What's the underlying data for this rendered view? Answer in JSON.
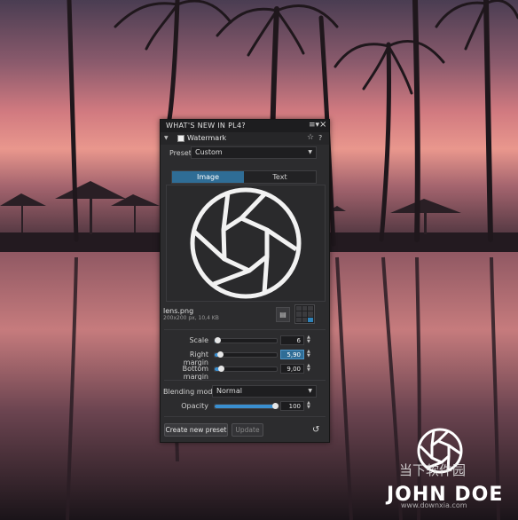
{
  "panel": {
    "title": "WHAT'S NEW IN PL4?",
    "menu_icon": "menu-icon",
    "close_icon": "close-icon",
    "section": {
      "label": "Watermark",
      "star_icon": "star-icon",
      "help_label": "?"
    },
    "preset": {
      "label": "Preset",
      "value": "Custom"
    },
    "tabs": [
      {
        "label": "Image"
      },
      {
        "label": "Text"
      }
    ],
    "file": {
      "name": "lens.png",
      "info": "200x200 px, 10,4 KB"
    },
    "sliders": [
      {
        "label": "Scale",
        "value": "6",
        "fraction": 0.0
      },
      {
        "label": "Right margin",
        "value": "5,90",
        "fraction": 0.04
      },
      {
        "label": "Bottom margin",
        "value": "9,00",
        "fraction": 0.06
      }
    ],
    "blending": {
      "label": "Blending mode",
      "value": "Normal"
    },
    "opacity": {
      "label": "Opacity",
      "value": "100",
      "fraction": 1.0
    },
    "buttons": {
      "create": "Create new preset",
      "update": "Update"
    },
    "colors": {
      "accent": "#2f6d96",
      "panel_bg": "#2c2c2e"
    }
  },
  "watermark": {
    "name": "JOHN DOE",
    "cn_text": "当下软件园",
    "cn_url": "www.downxia.com"
  }
}
